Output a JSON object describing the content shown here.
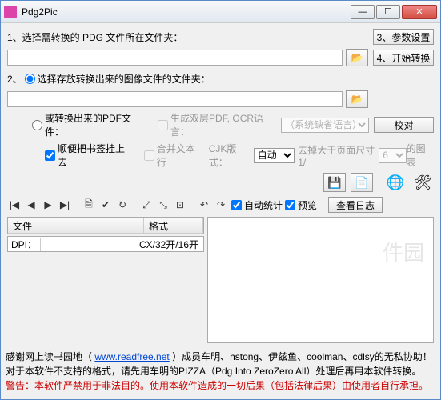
{
  "window": {
    "title": "Pdg2Pic"
  },
  "labels": {
    "step1": "1、选择需转换的 PDG 文件所在文件夹：",
    "step2": "2、",
    "step2b": " 选择存放转换出来的图像文件的文件夹：",
    "pdfRadio": " 或转换出来的PDF文件：",
    "dualPdf": " 生成双层PDF, OCR语言：",
    "bookmark": " 顺便把书签挂上去",
    "mergeLine": " 合并文本行",
    "cjkMode": "CJK版式：",
    "cutSize": "去掉大于页面尺寸1/",
    "chartSuffix": " 的图表",
    "autoStat": " 自动统计",
    "preview": " 预览",
    "viewLog": "查看日志",
    "fileCol": "文件",
    "fmtCol": "格式",
    "dpi": "DPI：",
    "cx": "CX/32开/16开"
  },
  "buttons": {
    "params": "3、参数设置",
    "start": "4、开始转换",
    "proofread": "校对"
  },
  "selects": {
    "ocrLang": "（系统缺省语言）",
    "cjk": "自动",
    "fraction": "6"
  },
  "checks": {
    "bookmark": true,
    "autoStat": true,
    "preview": true
  },
  "footer": {
    "line1a": "感谢网上读书园地（ ",
    "link": "www.readfree.net",
    "line1b": " ）成员车明、hstong、伊兹鱼、coolman、cdlsy的无私协助！",
    "line2": "对于本软件不支持的格式，请先用车明的PIZZA（Pdg Into ZeroZero All）处理后再用本软件转换。",
    "line3": "警告：本软件严禁用于非法目的。使用本软件造成的一切后果（包括法律后果）由使用者自行承担。"
  },
  "icons": {
    "folder": "📂",
    "save": "💾",
    "pdf": "📄",
    "globe": "🌐",
    "tools": "🛠"
  },
  "nav": {
    "first": "|◀",
    "prev": "◀",
    "next": "▶",
    "last": "▶|",
    "doc": "🗎",
    "check": "✔",
    "refresh": "↻",
    "zin": "⤢",
    "zout": "⤡",
    "fit": "⊡",
    "rotl": "↶",
    "rotr": "↷"
  }
}
